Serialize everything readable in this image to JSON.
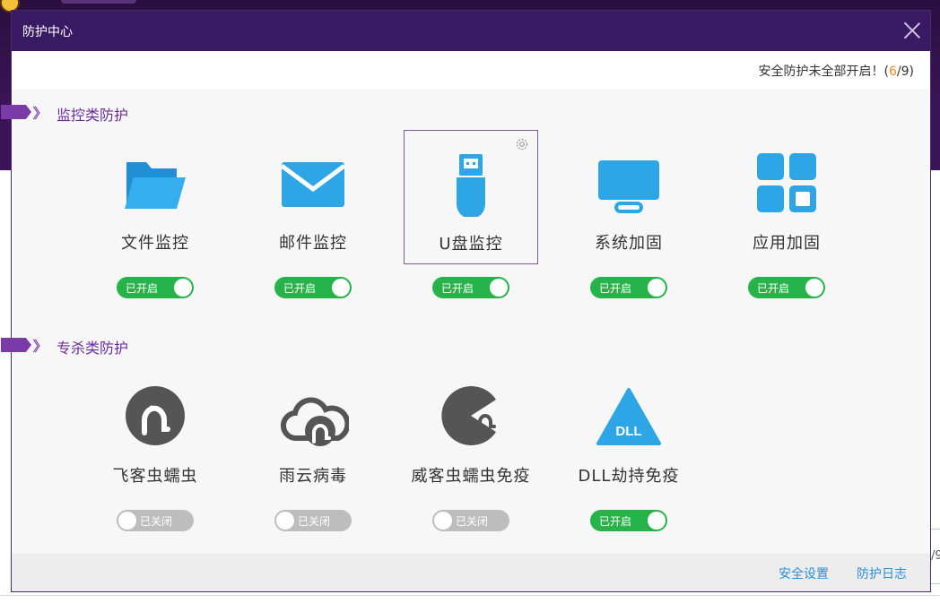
{
  "dialog": {
    "title": "防护中心",
    "status_prefix": "安全防护未全部开启！(",
    "status_on": "6",
    "status_suffix": "/9)"
  },
  "sections": [
    {
      "title": "监控类防护",
      "items": [
        {
          "label": "文件监控",
          "icon": "folder-icon",
          "state": "已开启",
          "on": true
        },
        {
          "label": "邮件监控",
          "icon": "mail-icon",
          "state": "已开启",
          "on": true
        },
        {
          "label": "U盘监控",
          "icon": "usb-drive-icon",
          "state": "已开启",
          "on": true
        },
        {
          "label": "系统加固",
          "icon": "monitor-icon",
          "state": "已开启",
          "on": true
        },
        {
          "label": "应用加固",
          "icon": "apps-grid-icon",
          "state": "已开启",
          "on": true
        }
      ]
    },
    {
      "title": "专杀类防护",
      "items": [
        {
          "label": "飞客虫蠕虫",
          "icon": "worm-icon",
          "state": "已关闭",
          "on": false
        },
        {
          "label": "雨云病毒",
          "icon": "cloud-virus-icon",
          "state": "已关闭",
          "on": false
        },
        {
          "label": "威客虫蠕虫免疫",
          "icon": "pacman-worm-icon",
          "state": "已关闭",
          "on": false
        },
        {
          "label": "DLL劫持免疫",
          "icon": "dll-triangle-icon",
          "icon_text": "DLL",
          "state": "已开启",
          "on": true
        }
      ]
    }
  ],
  "footer": {
    "settings_link": "安全设置",
    "log_link": "防护日志"
  },
  "background": {
    "partial_text": "/9"
  },
  "colors": {
    "titlebar": "#3a1b63",
    "accent": "#7a3aa8",
    "icon_blue": "#2ea6e6",
    "icon_dark": "#555555",
    "toggle_on": "#27b34a",
    "toggle_off": "#bdbdbd",
    "link": "#2a8fd8"
  }
}
